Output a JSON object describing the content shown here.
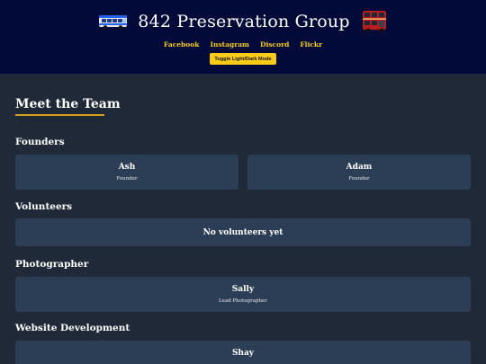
{
  "header": {
    "title": "842 Preservation Group",
    "left_logo": "bus-icon",
    "right_logo": "double-decker-bus-icon",
    "social_links": [
      "Facebook",
      "Instagram",
      "Discord",
      "Flickr"
    ],
    "toggle_label": "Toggle Light/Dark Mode",
    "background": "#020a3a",
    "accent": "#facc15"
  },
  "main": {
    "heading": "Meet the Team",
    "sections": {
      "founders": {
        "title": "Founders",
        "members": [
          {
            "name": "Ash",
            "role": "Founder"
          },
          {
            "name": "Adam",
            "role": "Founder"
          }
        ]
      },
      "volunteers": {
        "title": "Volunteers",
        "empty_text": "No volunteers yet"
      },
      "photographer": {
        "title": "Photographer",
        "members": [
          {
            "name": "Sally",
            "role": "Lead Photographer"
          }
        ]
      },
      "web_dev": {
        "title": "Website Development",
        "members": [
          {
            "name": "Shay",
            "role": ""
          }
        ]
      }
    }
  },
  "colors": {
    "page_bg": "#1f2937",
    "card_bg": "#2c3e55",
    "heading_underline": "#d4a017"
  }
}
